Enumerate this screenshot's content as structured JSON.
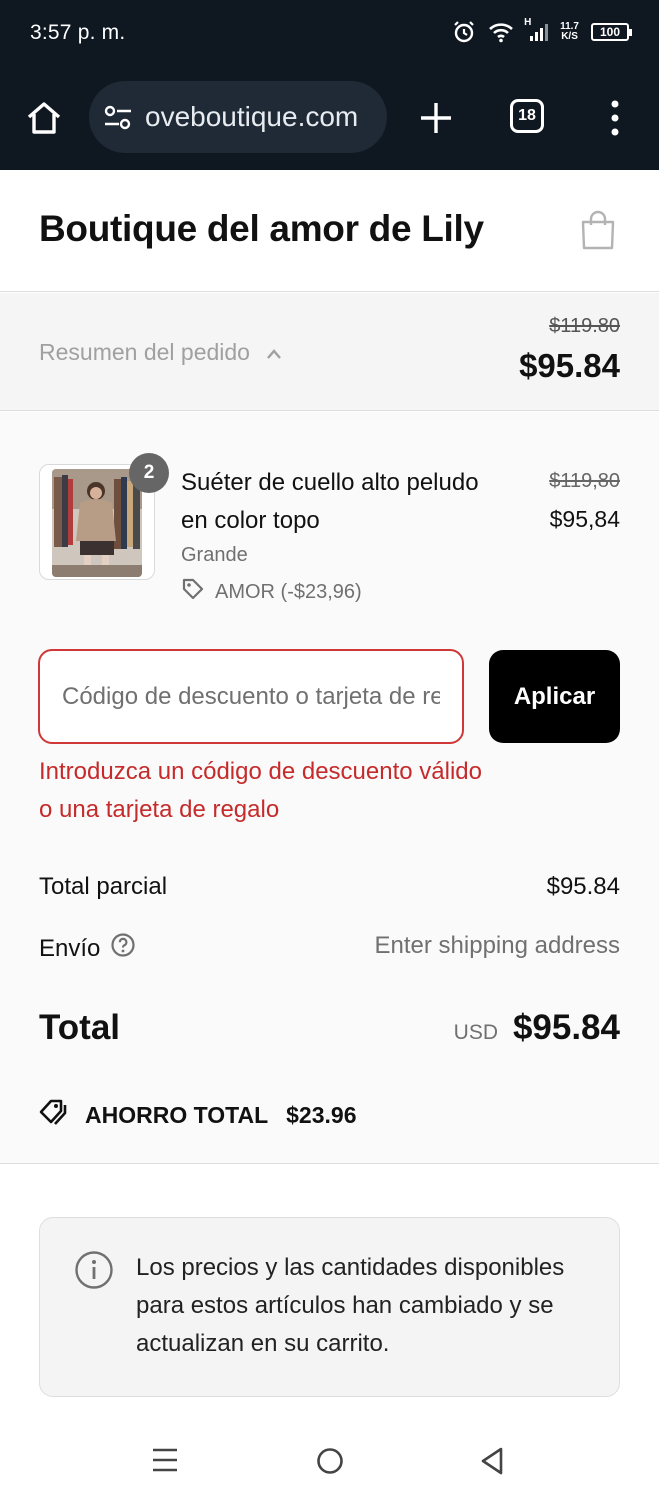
{
  "status_bar": {
    "time": "3:57 p. m.",
    "network_type": "H",
    "speed_value": "11.7",
    "speed_unit": "K/S",
    "battery": "100"
  },
  "browser": {
    "url": "oveboutique.com",
    "tab_count": "18"
  },
  "header": {
    "store_name": "Boutique del amor de Lily"
  },
  "summary": {
    "toggle_label": "Resumen del pedido",
    "original_total": "$119.80",
    "discounted_total": "$95.84"
  },
  "product": {
    "quantity": "2",
    "name": "Suéter de cuello alto peludo en color topo",
    "variant": "Grande",
    "discount_label": "AMOR (-$23,96)",
    "original_price": "$119,80",
    "price": "$95,84"
  },
  "discount": {
    "placeholder": "Código de descuento o tarjeta de regalo",
    "value": "",
    "apply_label": "Aplicar",
    "error": "Introduzca un código de descuento válido o una tarjeta de regalo"
  },
  "totals": {
    "subtotal_label": "Total parcial",
    "subtotal_value": "$95.84",
    "shipping_label": "Envío",
    "shipping_value": "Enter shipping address",
    "total_label": "Total",
    "currency": "USD",
    "total_value": "$95.84",
    "savings_label": "AHORRO TOTAL",
    "savings_value": "$23.96"
  },
  "notice": {
    "text": "Los precios y las cantidades disponibles para estos artículos han cambiado y se actualizan en su carrito."
  },
  "colors": {
    "chrome_bg": "#0f1720",
    "error": "#c52b2b",
    "button_bg": "#000000"
  },
  "icons": [
    "home-icon",
    "site-settings-icon",
    "plus-icon",
    "tabs-icon",
    "more-vert-icon",
    "shopping-bag-icon",
    "chevron-up-icon",
    "tag-icon",
    "help-circle-icon",
    "info-icon",
    "menu-icon",
    "home-circle-icon",
    "back-icon",
    "alarm-icon",
    "wifi-icon",
    "signal-icon",
    "battery-icon"
  ]
}
